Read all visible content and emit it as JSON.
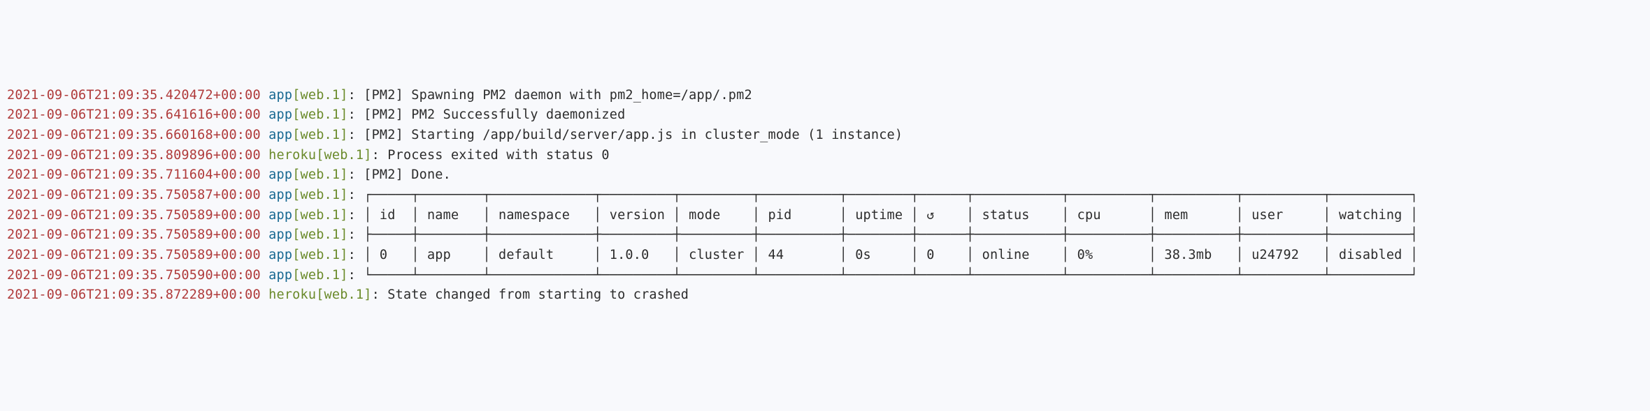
{
  "lines": [
    {
      "ts": "2021-09-06T21:09:35.420472+00:00",
      "src": "app",
      "dyno": "[web.1]",
      "sep": ": ",
      "msg": "[PM2] Spawning PM2 daemon with pm2_home=/app/.pm2"
    },
    {
      "ts": "2021-09-06T21:09:35.641616+00:00",
      "src": "app",
      "dyno": "[web.1]",
      "sep": ": ",
      "msg": "[PM2] PM2 Successfully daemonized"
    },
    {
      "ts": "2021-09-06T21:09:35.660168+00:00",
      "src": "app",
      "dyno": "[web.1]",
      "sep": ": ",
      "msg": "[PM2] Starting /app/build/server/app.js in cluster_mode (1 instance)"
    },
    {
      "ts": "2021-09-06T21:09:35.809896+00:00",
      "src": "heroku",
      "dyno": "[web.1]",
      "sep": ": ",
      "msg": "Process exited with status 0"
    },
    {
      "ts": "2021-09-06T21:09:35.711604+00:00",
      "src": "app",
      "dyno": "[web.1]",
      "sep": ": ",
      "msg": "[PM2] Done."
    },
    {
      "ts": "2021-09-06T21:09:35.750587+00:00",
      "src": "app",
      "dyno": "[web.1]",
      "sep": ": ",
      "msg": "┌─────┬────────┬─────────────┬─────────┬─────────┬──────────┬────────┬──────┬───────────┬──────────┬──────────┬──────────┬──────────┐"
    },
    {
      "ts": "2021-09-06T21:09:35.750589+00:00",
      "src": "app",
      "dyno": "[web.1]",
      "sep": ": ",
      "msg": "│ id  │ name   │ namespace   │ version │ mode    │ pid      │ uptime │ ↺    │ status    │ cpu      │ mem      │ user     │ watching │"
    },
    {
      "ts": "2021-09-06T21:09:35.750589+00:00",
      "src": "app",
      "dyno": "[web.1]",
      "sep": ": ",
      "msg": "├─────┼────────┼─────────────┼─────────┼─────────┼──────────┼────────┼──────┼───────────┼──────────┼──────────┼──────────┼──────────┤"
    },
    {
      "ts": "2021-09-06T21:09:35.750589+00:00",
      "src": "app",
      "dyno": "[web.1]",
      "sep": ": ",
      "msg": "│ 0   │ app    │ default     │ 1.0.0   │ cluster │ 44       │ 0s     │ 0    │ online    │ 0%       │ 38.3mb   │ u24792   │ disabled │"
    },
    {
      "ts": "2021-09-06T21:09:35.750590+00:00",
      "src": "app",
      "dyno": "[web.1]",
      "sep": ": ",
      "msg": "└─────┴────────┴─────────────┴─────────┴─────────┴──────────┴────────┴──────┴───────────┴──────────┴──────────┴──────────┴──────────┘"
    },
    {
      "ts": "2021-09-06T21:09:35.872289+00:00",
      "src": "heroku",
      "dyno": "[web.1]",
      "sep": ": ",
      "msg": "State changed from starting to crashed"
    }
  ]
}
